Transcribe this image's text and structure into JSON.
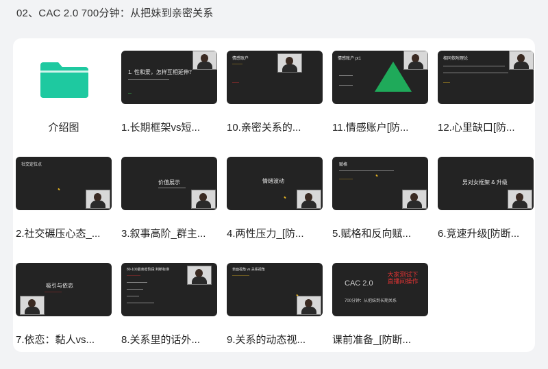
{
  "page": {
    "title": "02、CAC 2.0 700分钟：从把妹到亲密关系"
  },
  "icons": {
    "folder": "folder-icon",
    "presenter": "presenter-avatar-icon"
  },
  "colors": {
    "folder": "#1ec9a0",
    "thumb_bg": "#232323",
    "accent_red": "#d33030",
    "accent_yellow": "#e6b422",
    "triangle": "#1faa5a"
  },
  "items": [
    {
      "label": "介绍图",
      "type": "folder"
    },
    {
      "label": "1.长期框架vs短...",
      "slide_title": "1. 性和爱，怎样互相延伸？"
    },
    {
      "label": "10.亲密关系的...",
      "slide_title": "情感账户"
    },
    {
      "label": "11.情感账户[防...",
      "slide_title": "情感账户 pt1"
    },
    {
      "label": "12.心里缺口[防...",
      "slide_title": "相同依附理论"
    },
    {
      "label": "2.社交碾压心态_...",
      "slide_title": "社交定位点"
    },
    {
      "label": "3.叙事高阶_群主...",
      "slide_title": "价值展示"
    },
    {
      "label": "4.两性压力_[防...",
      "slide_title": "情绪波动"
    },
    {
      "label": "5.赋格和反向赋...",
      "slide_title": "赋格"
    },
    {
      "label": "6.竞速升级[防断...",
      "slide_title": "男对女框架 & 升级"
    },
    {
      "label": "7.依恋：黏人vs...",
      "slide_title": "吸引与依恋"
    },
    {
      "label": "8.关系里的话外...",
      "slide_title": "80-100最亲密阶段 判断标准"
    },
    {
      "label": "9.关系的动态视...",
      "slide_title": "表面视角 vs 关系视角"
    },
    {
      "label": "课前准备_[防断...",
      "slide_title": "CAC 2.0",
      "slide_note": "大家测试下直播间操作",
      "slide_sub": "700分钟：从把妹到长期关系"
    }
  ]
}
